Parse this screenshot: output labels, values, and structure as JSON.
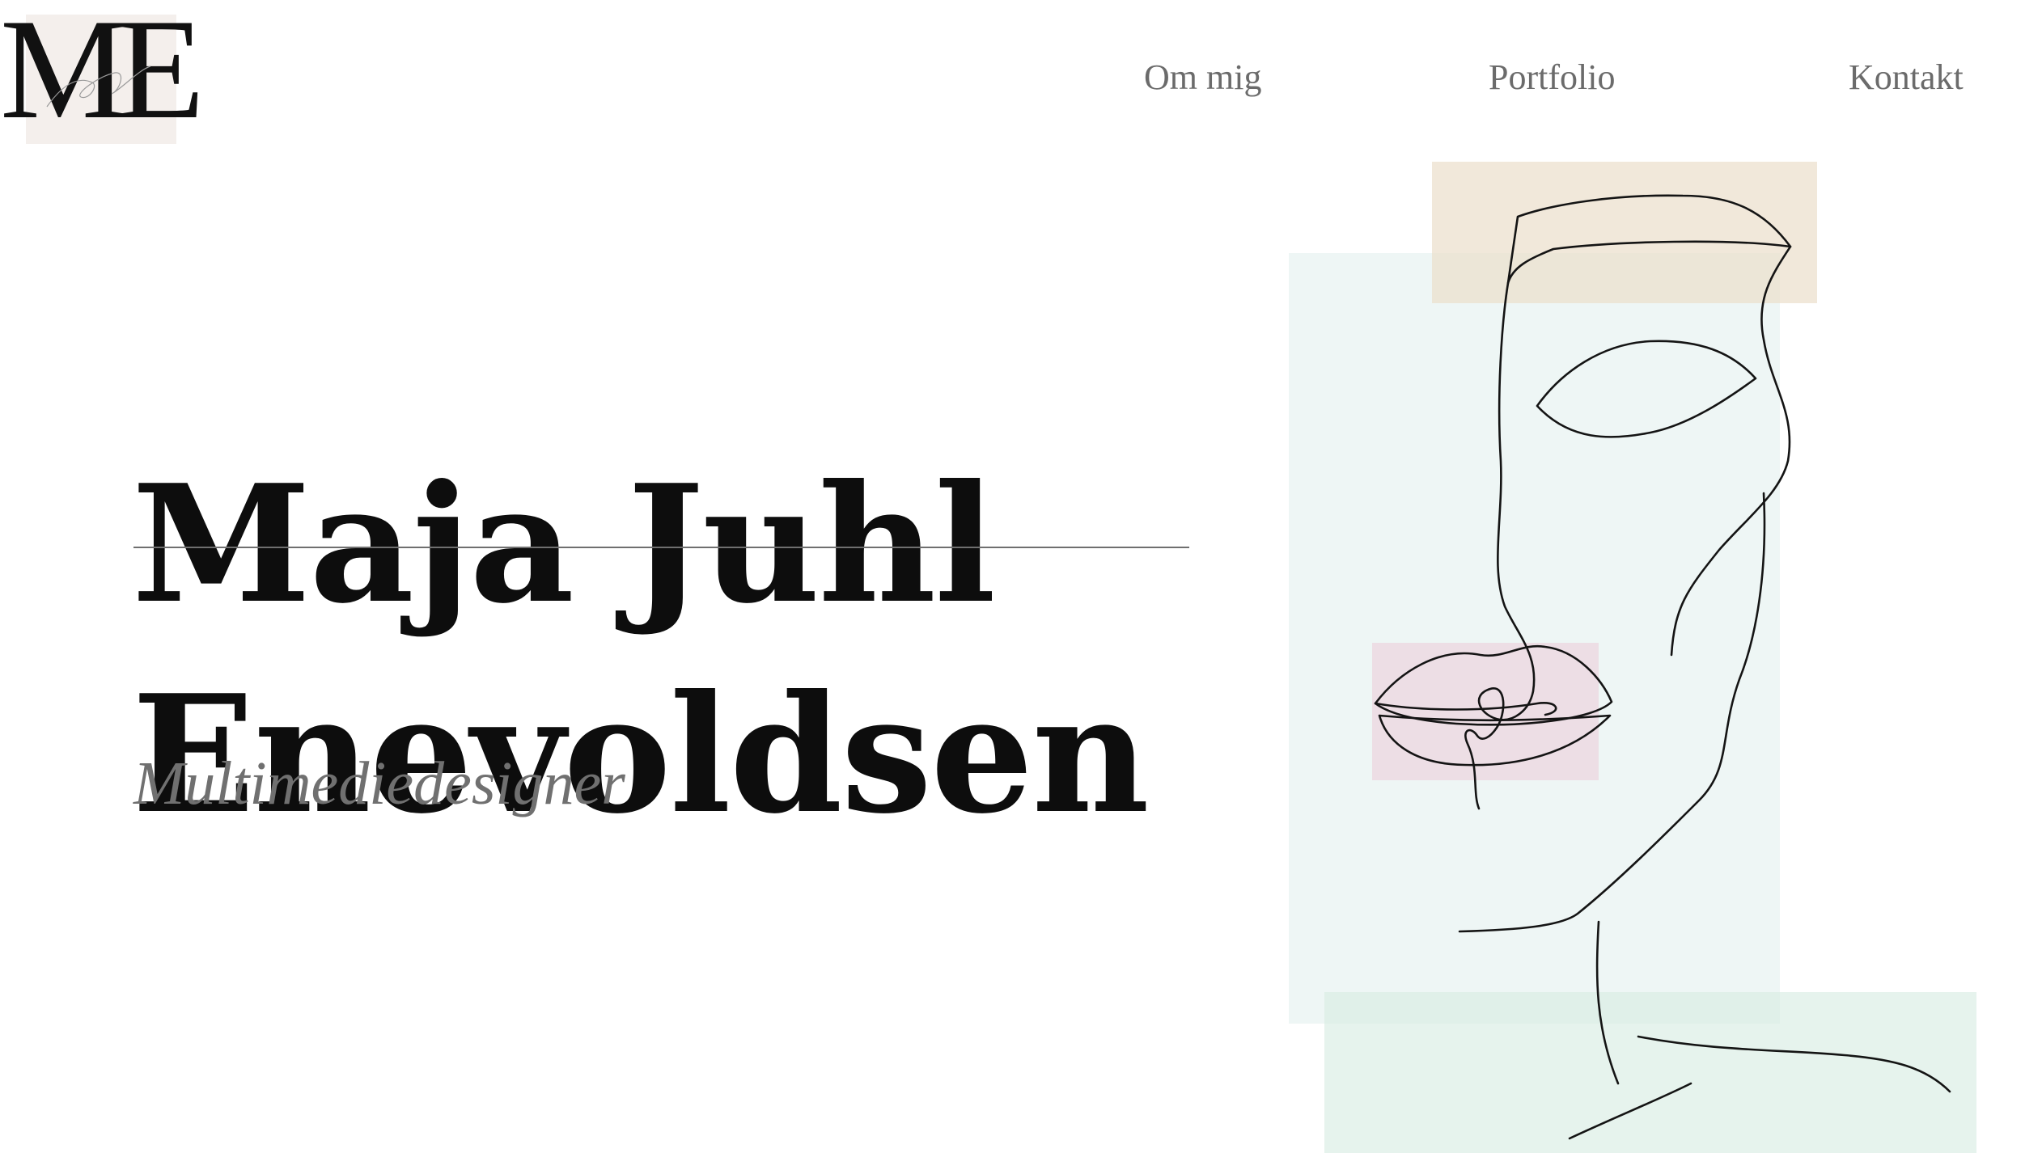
{
  "header": {
    "logo": {
      "text": "ME"
    },
    "nav": {
      "items": [
        {
          "label": "Om mig"
        },
        {
          "label": "Portfolio"
        },
        {
          "label": "Kontakt"
        }
      ]
    }
  },
  "hero": {
    "first_name": "Maja Juhl",
    "last_name": "Enevoldsen",
    "role": "Multimediedesigner"
  },
  "illustration": {
    "description_icon": "line-art-face-icon",
    "colors": {
      "mint": "#eef6f5",
      "sand": "#ebdfcc",
      "pink": "#ecdbe3",
      "sage": "#d6ebe2",
      "line": "#141414"
    }
  }
}
